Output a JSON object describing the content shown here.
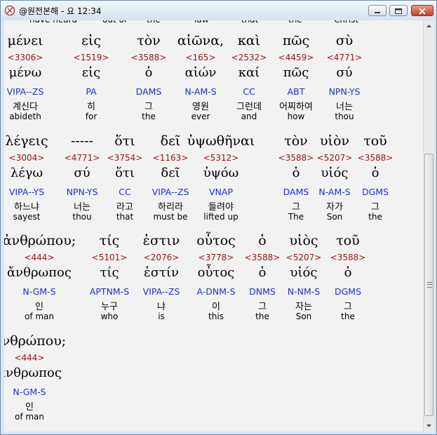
{
  "window": {
    "title": "@원전본해 - 요 12:34",
    "buttons": [
      "minimize",
      "maximize",
      "close"
    ]
  },
  "partial_top_row": [
    "have heard",
    "out of",
    "the",
    "law",
    "that",
    "the",
    "Christ"
  ],
  "blocks": [
    {
      "words": [
        {
          "greek": "μένει",
          "strong": "<3306>",
          "lemma": "μένω",
          "parsing": "VIPA--ZS",
          "korean": "계신다",
          "english": "abideth"
        },
        {
          "greek": "εἰς",
          "strong": "<1519>",
          "lemma": "εἰς",
          "parsing": "PA",
          "korean": "히",
          "english": "for"
        },
        {
          "greek": "τὸν",
          "strong": "<3588>",
          "lemma": "ὁ",
          "parsing": "DAMS",
          "korean": "그",
          "english": "the"
        },
        {
          "greek": "αἰῶνα,",
          "strong": "<165>",
          "lemma": "αἰών",
          "parsing": "N-AM-S",
          "korean": "영원",
          "english": "ever"
        },
        {
          "greek": "καὶ",
          "strong": "<2532>",
          "lemma": "καί",
          "parsing": "CC",
          "korean": "그런데",
          "english": "and"
        },
        {
          "greek": "πῶς",
          "strong": "<4459>",
          "lemma": "πῶς",
          "parsing": "ABT",
          "korean": "어찌하여",
          "english": "how"
        },
        {
          "greek": "σὺ",
          "strong": "<4771>",
          "lemma": "σύ",
          "parsing": "NPN-YS",
          "korean": "너는",
          "english": "thou"
        }
      ]
    },
    {
      "words": [
        {
          "greek": "λέγεις",
          "strong": "<3004>",
          "lemma": "λέγω",
          "parsing": "VIPA--YS",
          "korean": "하느냐",
          "english": "sayest"
        },
        {
          "greek": "-----",
          "strong": "<4771>",
          "lemma": "σύ",
          "parsing": "NPN-YS",
          "korean": "너는",
          "english": "thou"
        },
        {
          "greek": "ὅτι",
          "strong": "<3754>",
          "lemma": "ὅτι",
          "parsing": "CC",
          "korean": "라고",
          "english": "that"
        },
        {
          "greek": "δεῖ",
          "strong": "<1163>",
          "lemma": "δεῖ",
          "parsing": "VIPA--ZS",
          "korean": "하리라",
          "english": "must be"
        },
        {
          "greek": "ὑψωθῆναι",
          "strong": "<5312>",
          "lemma": "ὑψόω",
          "parsing": "VNAP",
          "korean": "들려야",
          "english": "lifted up"
        },
        {
          "greek": "τὸν",
          "strong": "<3588>",
          "lemma": "ὁ",
          "parsing": "DAMS",
          "korean": "그",
          "english": "The"
        },
        {
          "greek": "υἱὸν",
          "strong": "<5207>",
          "lemma": "υἱός",
          "parsing": "N-AM-S",
          "korean": "자가",
          "english": "Son"
        },
        {
          "greek": "τοῦ",
          "strong": "<3588>",
          "lemma": "ὁ",
          "parsing": "DGMS",
          "korean": "그",
          "english": "the"
        }
      ]
    },
    {
      "words": [
        {
          "greek": "ἀνθρώπου;",
          "strong": "<444>",
          "lemma": "ἄνθρωπος",
          "parsing": "N-GM-S",
          "korean": "인",
          "english": "of man"
        },
        {
          "greek": "τίς",
          "strong": "<5101>",
          "lemma": "τίς",
          "parsing": "APTNM-S",
          "korean": "누구",
          "english": "who"
        },
        {
          "greek": "ἐστιν",
          "strong": "<2076>",
          "lemma": "ἐστίν",
          "parsing": "VIPA--ZS",
          "korean": "냐",
          "english": "is"
        },
        {
          "greek": "οὗτος",
          "strong": "<3778>",
          "lemma": "οὗτος",
          "parsing": "A-DNM-S",
          "korean": "이",
          "english": "this"
        },
        {
          "greek": "ὁ",
          "strong": "<3588>",
          "lemma": "ὁ",
          "parsing": "DNMS",
          "korean": "그",
          "english": "the"
        },
        {
          "greek": "υἱὸς",
          "strong": "<5207>",
          "lemma": "υἱός",
          "parsing": "N-NM-S",
          "korean": "자는",
          "english": "Son"
        },
        {
          "greek": "τοῦ",
          "strong": "<3588>",
          "lemma": "ὁ",
          "parsing": "DGMS",
          "korean": "그",
          "english": "the"
        }
      ]
    },
    {
      "words": [
        {
          "greek": "ἀνθρώπου;",
          "strong": "<444>",
          "lemma": "ἄνθρωπος",
          "parsing": "N-GM-S",
          "korean": "인",
          "english": "of man"
        }
      ]
    }
  ],
  "colors": {
    "strong": "#9a1212",
    "parsing": "#1c2fd0",
    "text": "#000000",
    "background": "#f2f2f2"
  }
}
